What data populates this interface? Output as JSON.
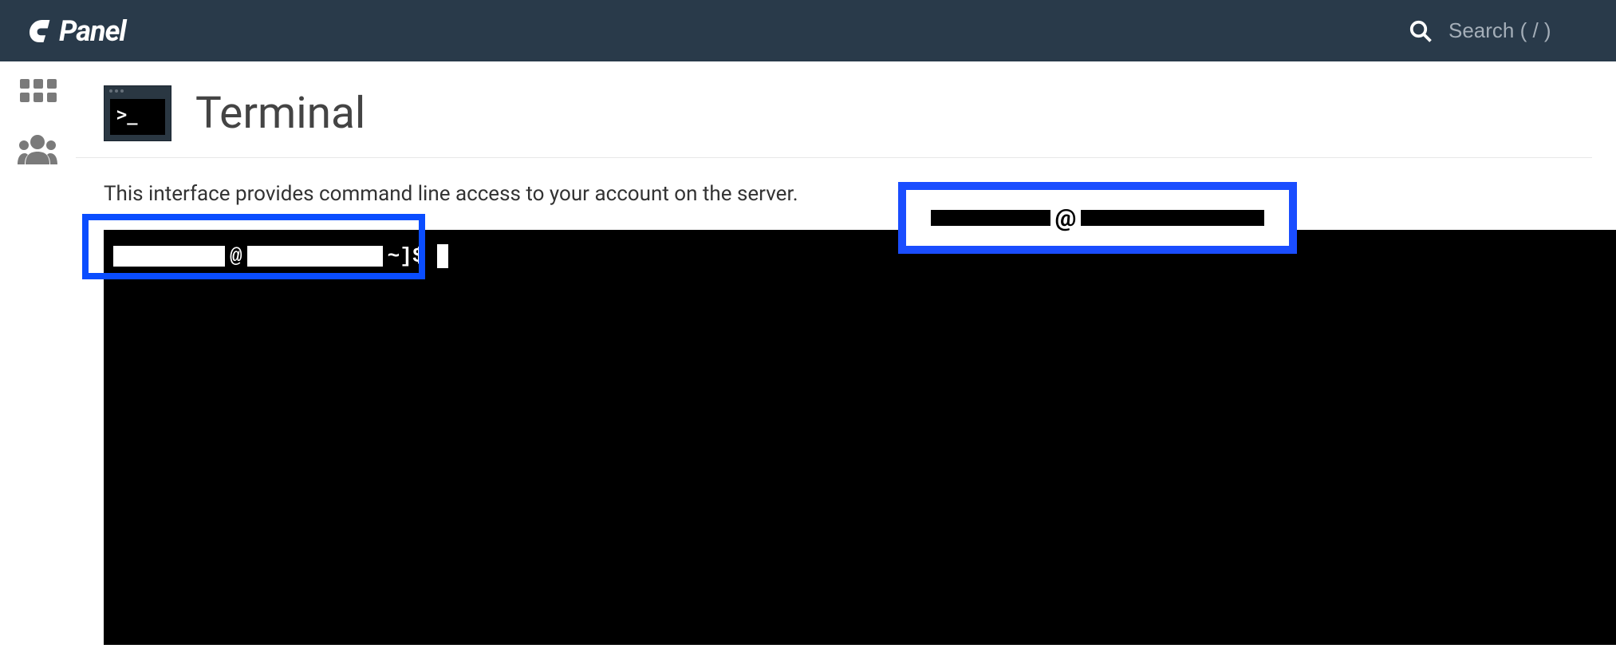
{
  "header": {
    "logo_text": "Panel",
    "search_placeholder": "Search ( / )"
  },
  "page": {
    "title": "Terminal",
    "description": "This interface provides command line access to your account on the server.",
    "tile_prompt": ">_"
  },
  "terminal": {
    "prompt_user_redacted": true,
    "prompt_suffix": " ~]$",
    "callout_at": "@"
  }
}
